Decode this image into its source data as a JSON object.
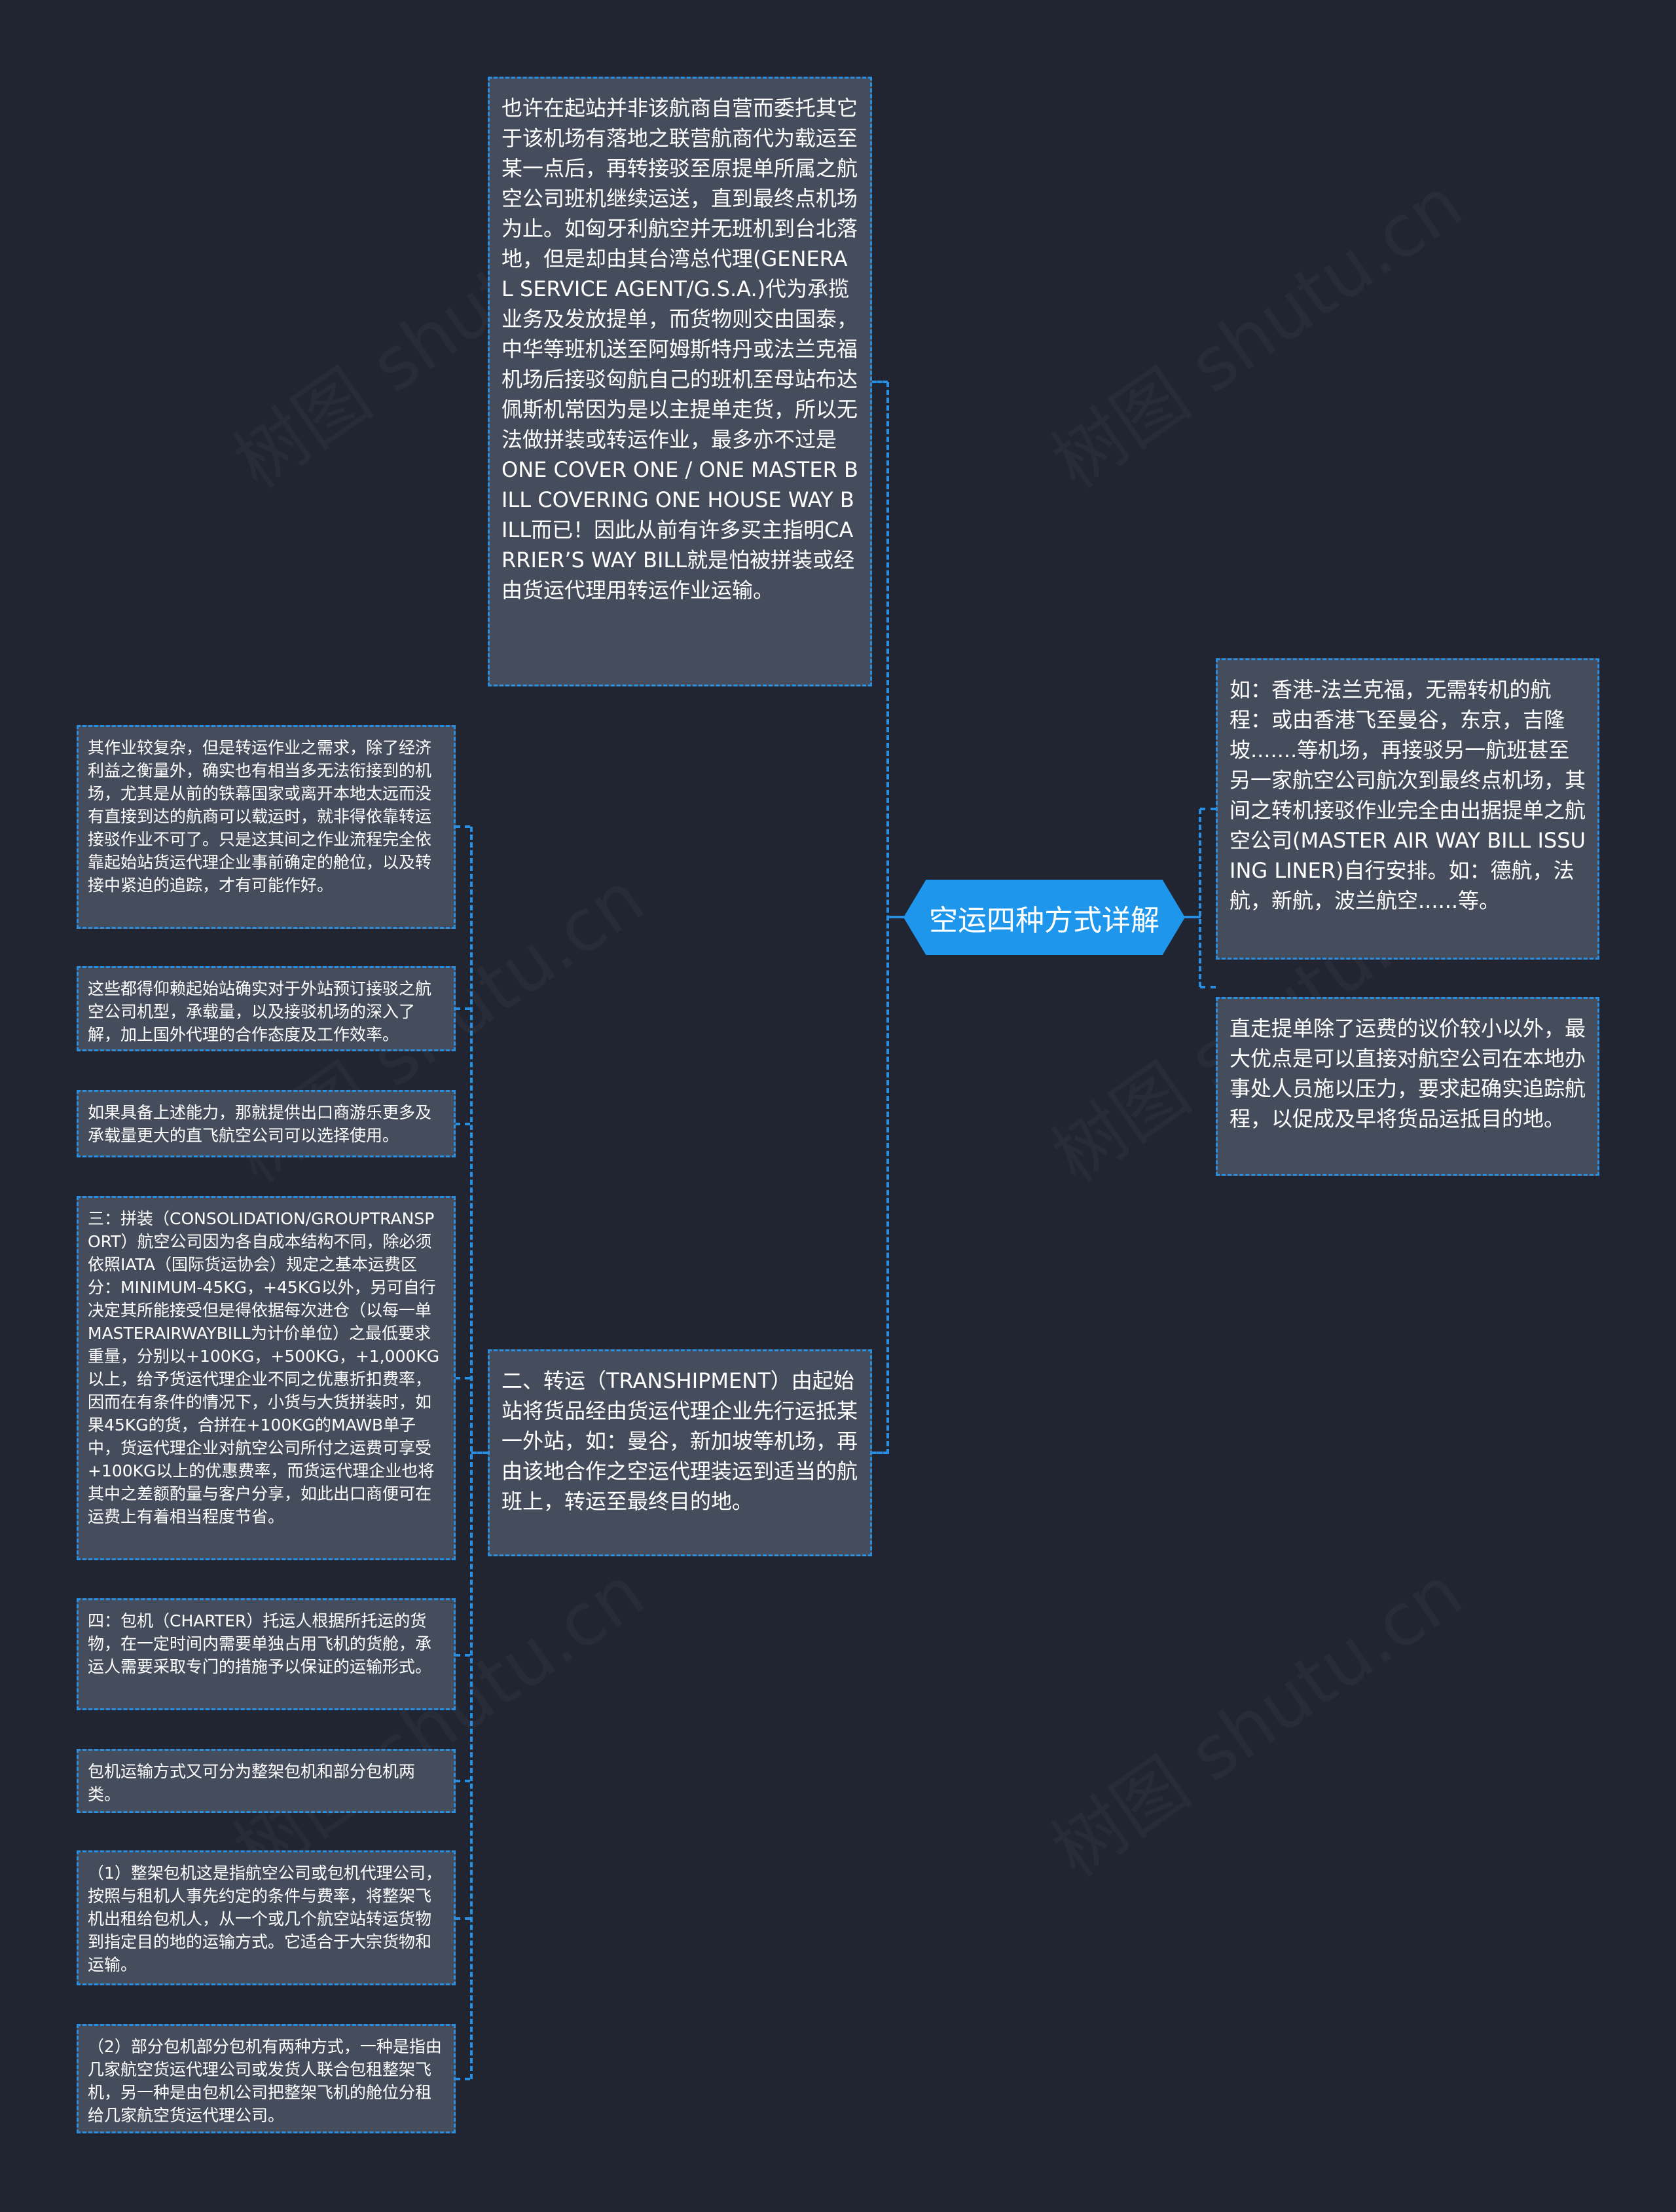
{
  "root": {
    "title": "空运四种方式详解"
  },
  "watermark": "树图 shutu.cn",
  "colors": {
    "background": "#212532",
    "node_fill": "#454c5c",
    "accent": "#1e96ec",
    "border": "#2a8fe0"
  },
  "top_node": {
    "text": "也许在起站并非该航商自营而委托其它于该机场有落地之联营航商代为载运至某一点后，再转接驳至原提单所属之航空公司班机继续运送，直到最终点机场为止。如匈牙利航空并无班机到台北落地，但是却由其台湾总代理(GENERAL SERVICE AGENT/G.S.A.)代为承揽业务及发放提单，而货物则交由国泰，中华等班机送至阿姆斯特丹或法兰克福机场后接驳匈航自己的班机至母站布达佩斯机常因为是以主提单走货，所以无法做拼装或转运作业，最多亦不过是 ONE COVER ONE / ONE MASTER BILL COVERING ONE HOUSE WAY BILL而已！因此从前有许多买主指明CARRIER’S WAY BILL就是怕被拼装或经由货运代理用转运作业运输。"
  },
  "transhipment_node": {
    "text": "二、转运（TRANSHIPMENT）由起始站将货品经由货运代理企业先行运抵某一外站，如：曼谷，新加坡等机场，再由该地合作之空运代理装运到适当的航班上，转运至最终目的地。"
  },
  "right_nodes": [
    {
      "text": "如：香港-法兰克福，无需转机的航程：或由香港飞至曼谷，东京，吉隆坡.......等机场，再接驳另一航班甚至另一家航空公司航次到最终点机场，其间之转机接驳作业完全由出据提单之航空公司(MASTER AIR WAY BILL ISSUING LINER)自行安排。如：德航，法航，新航，波兰航空......等。"
    },
    {
      "text": "直走提单除了运费的议价较小以外，最大优点是可以直接对航空公司在本地办事处人员施以压力，要求起确实追踪航程，以促成及早将货品运抵目的地。"
    }
  ],
  "left_nodes": [
    {
      "text": "其作业较复杂，但是转运作业之需求，除了经济利益之衡量外，确实也有相当多无法衔接到的机场，尤其是从前的铁幕国家或离开本地太远而没有直接到达的航商可以载运时，就非得依靠转运接驳作业不可了。只是这其间之作业流程完全依靠起始站货运代理企业事前确定的舱位，以及转接中紧迫的追踪，才有可能作好。"
    },
    {
      "text": "这些都得仰赖起始站确实对于外站预订接驳之航空公司机型，承载量，以及接驳机场的深入了解，加上国外代理的合作态度及工作效率。"
    },
    {
      "text": "如果具备上述能力，那就提供出口商游乐更多及承载量更大的直飞航空公司可以选择使用。"
    },
    {
      "text": "三：拼装（CONSOLIDATION/GROUPTRANSPORT）航空公司因为各自成本结构不同，除必须依照IATA（国际货运协会）规定之基本运费区分：MINIMUM-45KG，+45KG以外，另可自行决定其所能接受但是得依据每次进仓（以每一单MASTERAIRWAYBILL为计价单位）之最低要求重量，分别以+100KG，+500KG，+1,000KG以上，给予货运代理企业不同之优惠折扣费率，因而在有条件的情况下，小货与大货拼装时，如果45KG的货，合拼在+100KG的MAWB单子中，货运代理企业对航空公司所付之运费可享受+100KG以上的优惠费率，而货运代理企业也将其中之差额酌量与客户分享，如此出口商便可在运费上有着相当程度节省。"
    },
    {
      "text": "四：包机（CHARTER）托运人根据所托运的货物，在一定时间内需要单独占用飞机的货舱，承运人需要采取专门的措施予以保证的运输形式。"
    },
    {
      "text": "包机运输方式又可分为整架包机和部分包机两类。"
    },
    {
      "text": "（1）整架包机这是指航空公司或包机代理公司，按照与租机人事先约定的条件与费率，将整架飞机出租给包机人，从一个或几个航空站转运货物到指定目的地的运输方式。它适合于大宗货物和运输。"
    },
    {
      "text": "（2）部分包机部分包机有两种方式，一种是指由几家航空货运代理公司或发货人联合包租整架飞机，另一种是由包机公司把整架飞机的舱位分租给几家航空货运代理公司。"
    }
  ]
}
